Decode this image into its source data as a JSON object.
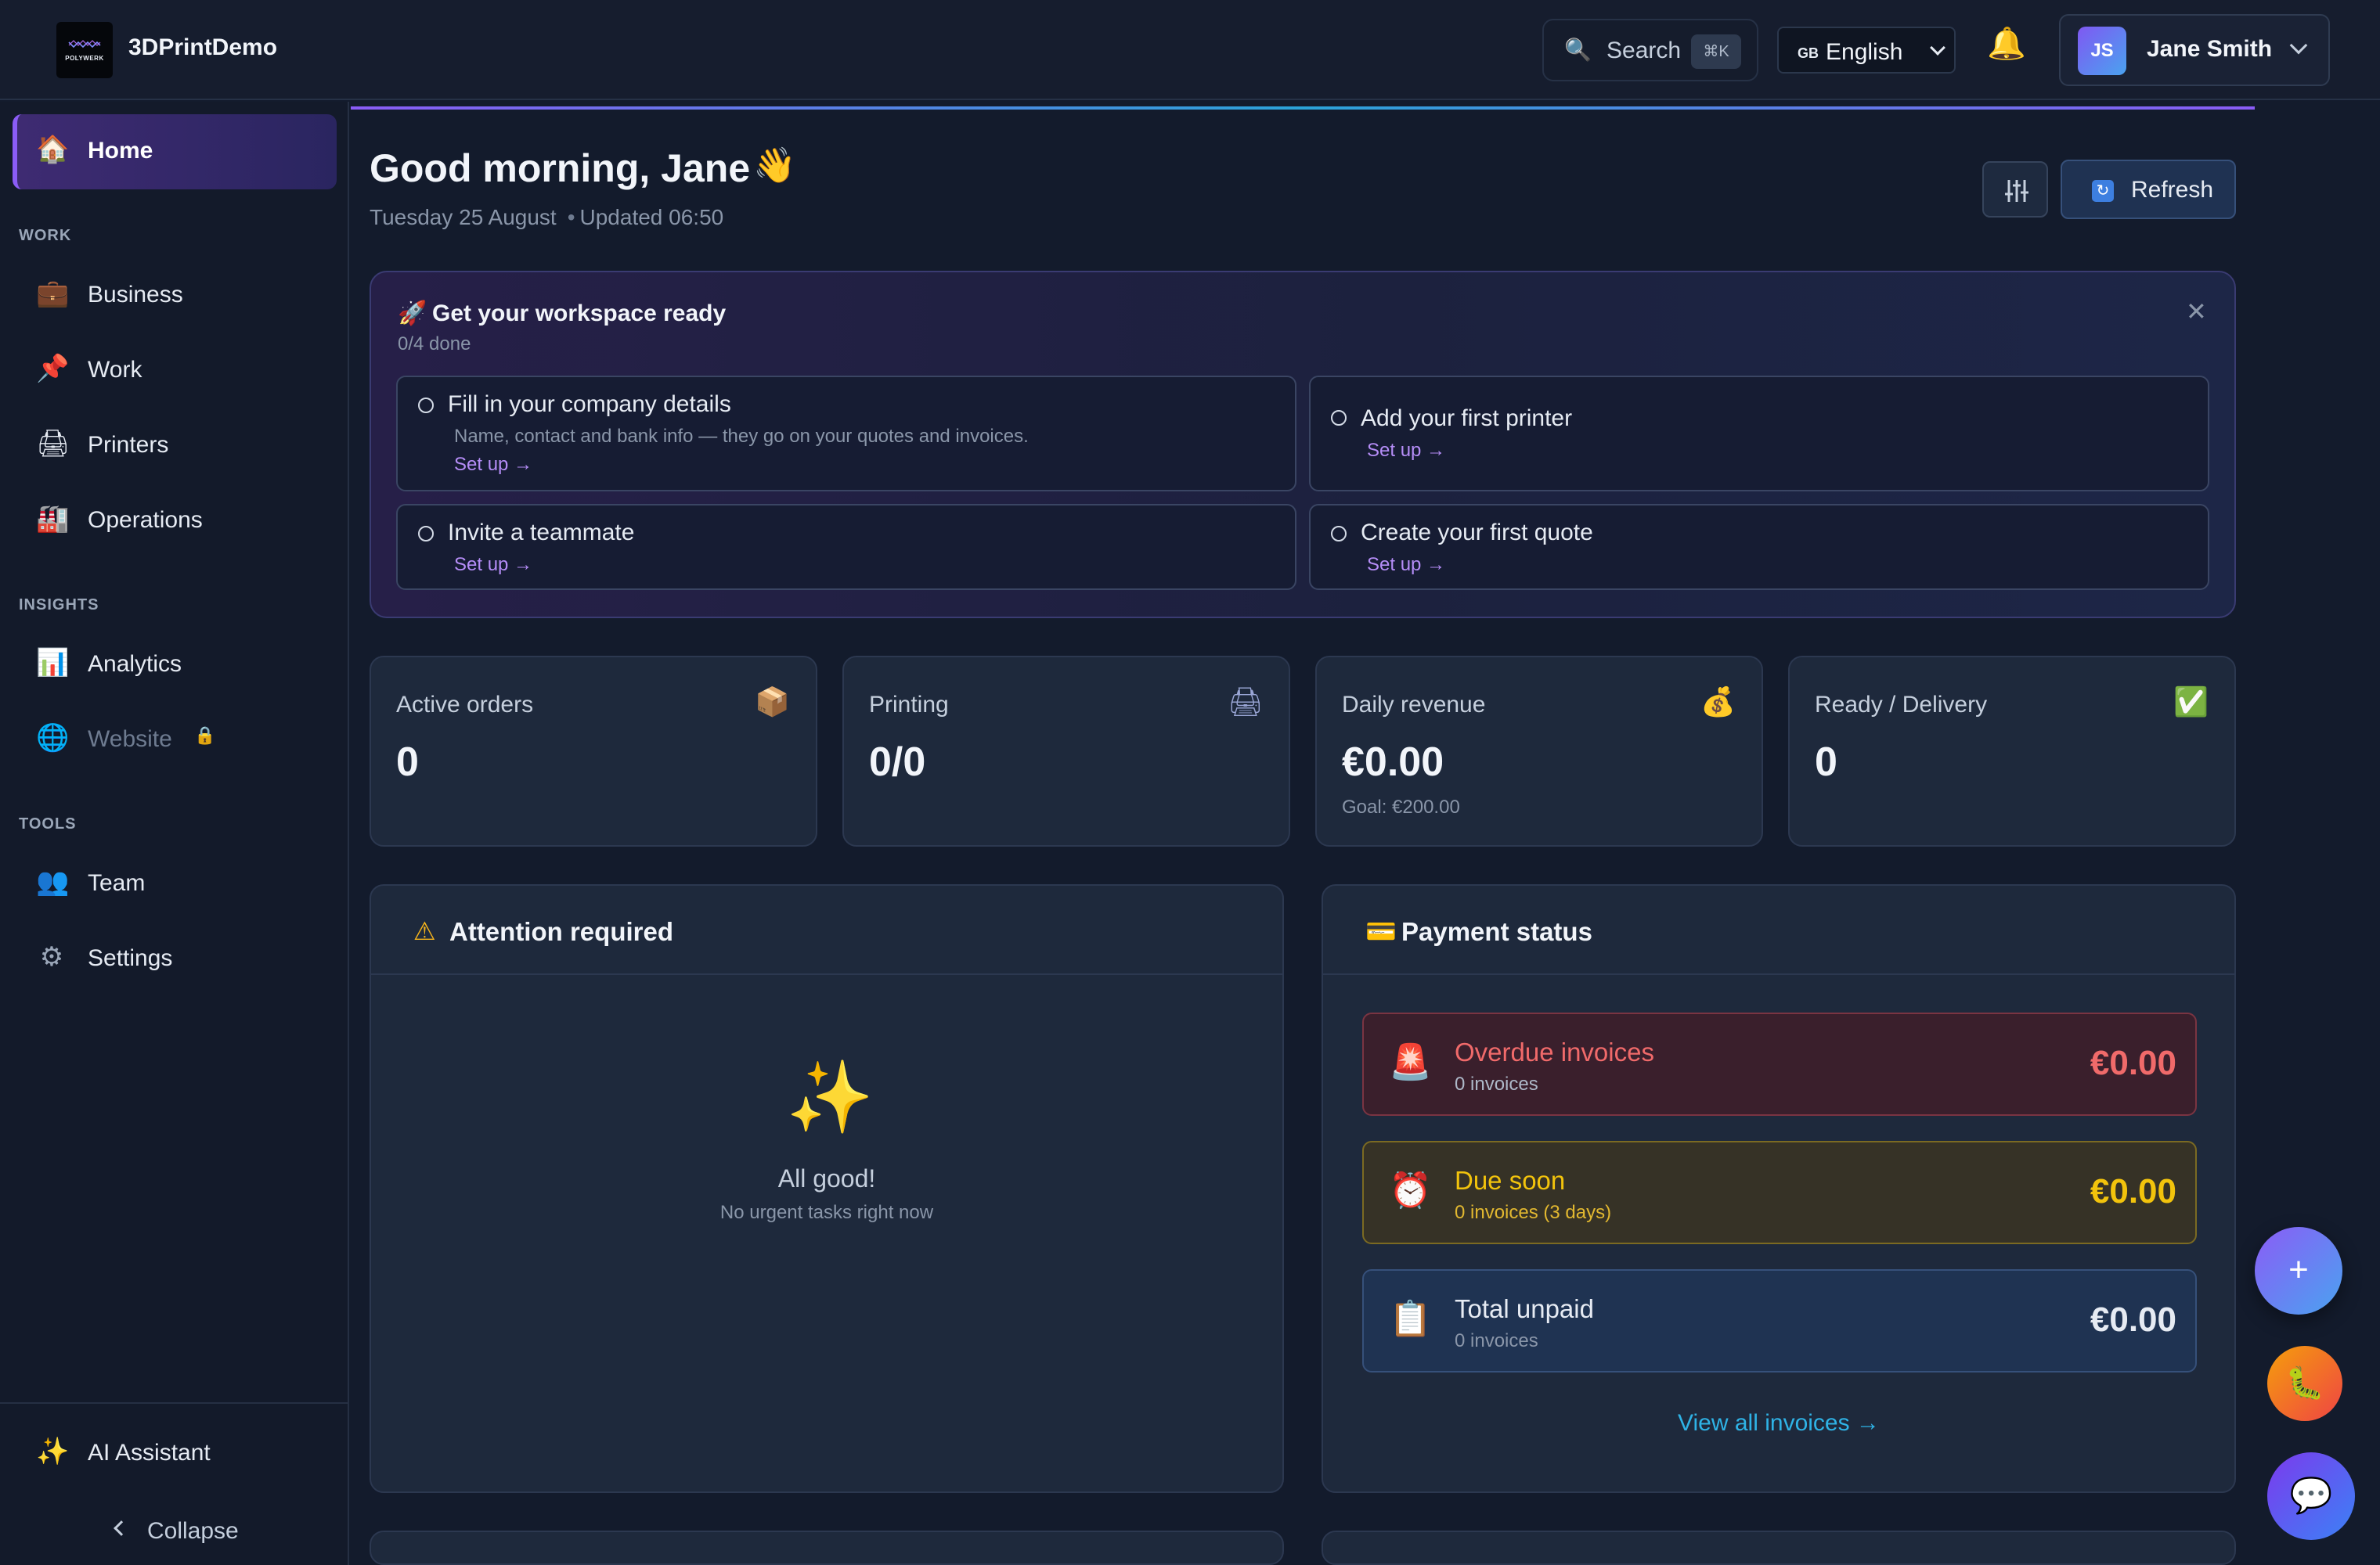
{
  "header": {
    "logo_text": "POLYWERK",
    "brand": "3DPrintDemo",
    "search": {
      "label": "Search",
      "shortcut": "⌘K",
      "icon": "search-icon"
    },
    "language": {
      "flag": "GB",
      "value": "English"
    },
    "user": {
      "initials": "JS",
      "name": "Jane Smith"
    }
  },
  "sidebar": {
    "home": {
      "label": "Home",
      "icon": "house-icon"
    },
    "sections": {
      "work": "WORK",
      "insights": "INSIGHTS",
      "tools": "TOOLS"
    },
    "items": {
      "business": "Business",
      "work": "Work",
      "printers": "Printers",
      "operations": "Operations",
      "analytics": "Analytics",
      "website": "Website",
      "team": "Team",
      "settings": "Settings"
    },
    "ai_assistant": "AI Assistant",
    "collapse": "Collapse"
  },
  "main": {
    "greeting": "Good morning, Jane",
    "date": "Tuesday 25 August",
    "updated": "Updated 06:50",
    "refresh_label": "Refresh"
  },
  "onboarding": {
    "title": "Get your workspace ready",
    "progress": "0/4 done",
    "tasks": [
      {
        "title": "Fill in your company details",
        "description": "Name, contact and bank info — they go on your quotes and invoices.",
        "link": "Set up →"
      },
      {
        "title": "Add your first printer",
        "link": "Set up →"
      },
      {
        "title": "Invite a teammate",
        "link": "Set up →"
      },
      {
        "title": "Create your first quote",
        "link": "Set up →"
      }
    ]
  },
  "stats": [
    {
      "label": "Active orders",
      "value": "0",
      "icon": "package-icon"
    },
    {
      "label": "Printing",
      "value": "0/0",
      "icon": "printer-icon"
    },
    {
      "label": "Daily revenue",
      "value": "€0.00",
      "goal": "Goal: €200.00",
      "icon": "money-bag-icon"
    },
    {
      "label": "Ready / Delivery",
      "value": "0",
      "icon": "check-box-icon"
    }
  ],
  "attention": {
    "title": "Attention required",
    "empty_title": "All good!",
    "empty_subtitle": "No urgent tasks right now"
  },
  "payments": {
    "title": "Payment status",
    "rows": [
      {
        "title": "Overdue invoices",
        "subtitle": "0 invoices",
        "amount": "€0.00",
        "color": "#f06a6a"
      },
      {
        "title": "Due soon",
        "subtitle": "0 invoices (3 days)",
        "amount": "€0.00",
        "color": "#f2c30c"
      },
      {
        "title": "Total unpaid",
        "subtitle": "0 invoices",
        "amount": "€0.00",
        "color": "#e6ebf3"
      }
    ],
    "view_all": "View all invoices →"
  },
  "colors": {
    "accent": "#8b5cf6",
    "link": "#2fb3e6",
    "background": "#131b2c",
    "card": "#1e293c"
  }
}
